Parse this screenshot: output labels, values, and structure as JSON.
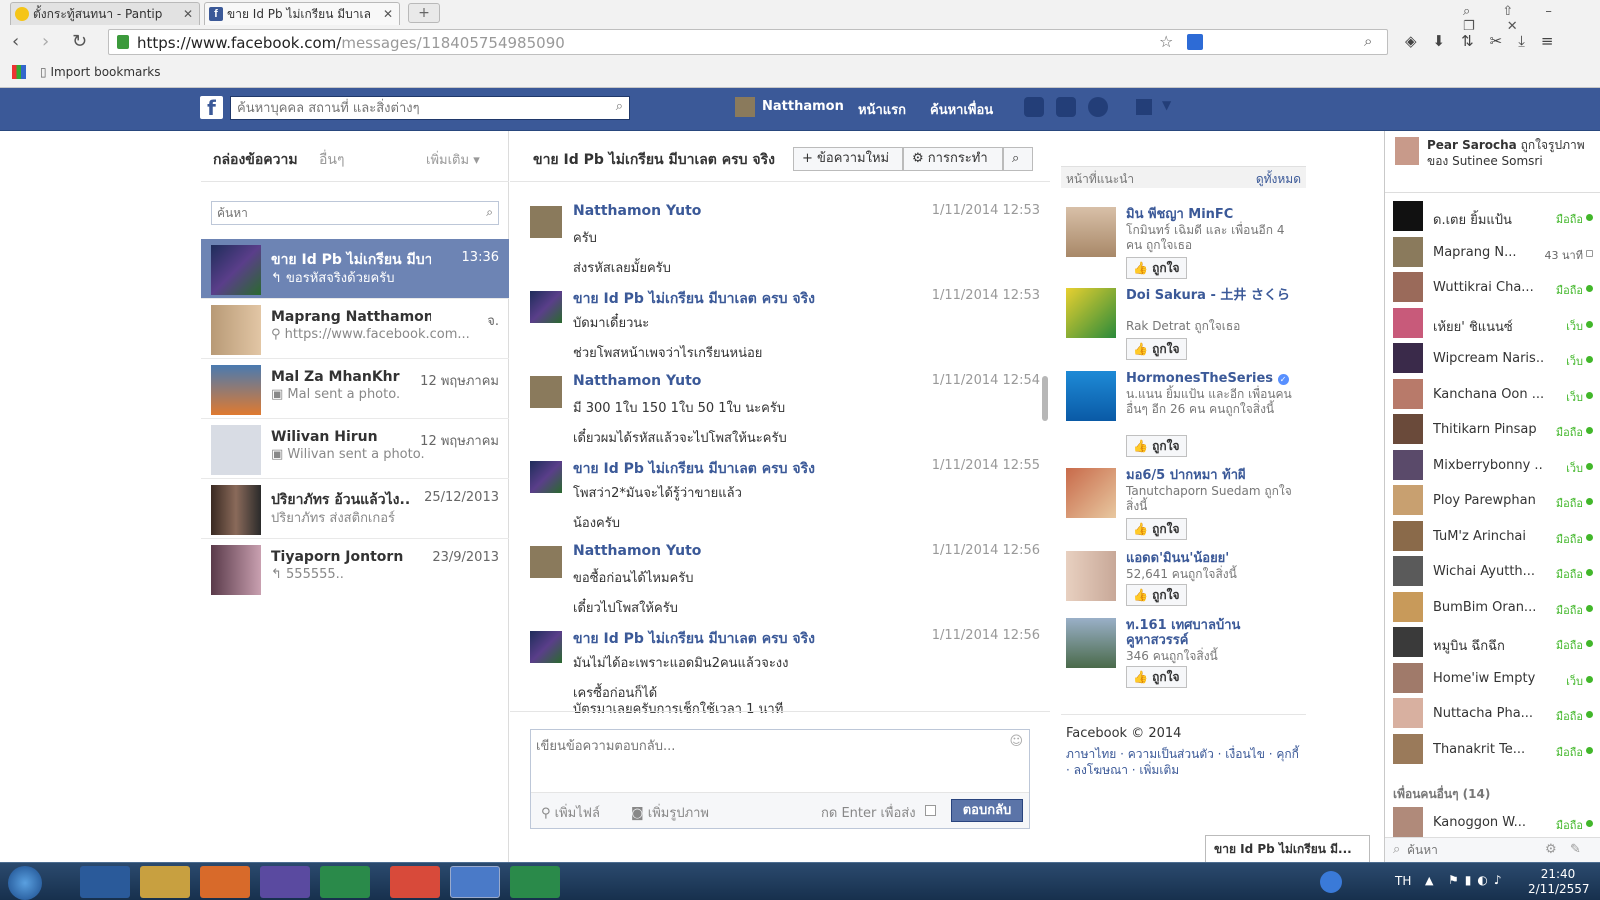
{
  "browser": {
    "tabs": [
      {
        "title": "ตั้งกระทู้สนทนา - Pantip"
      },
      {
        "title": "ขาย Id Pb ไม่เกรียน มีบาเล"
      }
    ],
    "new_tab": "+",
    "url_host": "https://www.facebook.com/",
    "url_path": "messages/118405754985090",
    "bookmark": "Import bookmarks"
  },
  "fb_header": {
    "search_placeholder": "ค้นหาบุคคล สถานที่ และสิ่งต่างๆ",
    "user_name": "Natthamon",
    "home": "หน้าแรก",
    "find_friends": "ค้นหาเพื่อน"
  },
  "inbox": {
    "title": "กล่องข้อความ",
    "other": "อื่นๆ",
    "more": "เพิ่มเติม",
    "search_placeholder": "ค้นหา",
    "conversations": [
      {
        "name": "ขาย Id Pb ไม่เกรียน มีบาเล.",
        "date": "13:36",
        "snippet": "ขอรหัสจริงด้วยครับ"
      },
      {
        "name": "Maprang Natthamon Yuto",
        "date": "จ.",
        "snippet": "https://www.facebook.com..."
      },
      {
        "name": "Mal Za MhanKhr",
        "date": "12 พฤษภาคม",
        "snippet": "Mal sent a photo."
      },
      {
        "name": "Wilivan Hirun",
        "date": "12 พฤษภาคม",
        "snippet": "Wilivan sent a photo."
      },
      {
        "name": "ปริยาภัทร อ้วนแล้วไง..",
        "date": "25/12/2013",
        "snippet": "ปริยาภัทร ส่งสติกเกอร์"
      },
      {
        "name": "Tiyaporn Jontorn",
        "date": "23/9/2013",
        "snippet": "555555.."
      }
    ]
  },
  "thread": {
    "title": "ขาย Id Pb ไม่เกรียน มีบาเลต ครบ จริง",
    "new_message": "ข้อความใหม่",
    "actions": "การกระทำ",
    "messages": [
      {
        "sender": "Natthamon Yuto",
        "time": "1/11/2014 12:53",
        "lines": [
          "ครับ",
          "ส่งรหัสเลยมั้ยครับ"
        ]
      },
      {
        "sender": "ขาย Id Pb ไม่เกรียน มีบาเลต ครบ จริง",
        "time": "1/11/2014 12:53",
        "lines": [
          "บัดมาเดี๋ยวนะ",
          "ช่วยโพสหน้าเพจว่าไรเกรียนหน่อย"
        ]
      },
      {
        "sender": "Natthamon Yuto",
        "time": "1/11/2014 12:54",
        "lines": [
          "มี 300 1ใบ 150 1ใบ 50 1ใบ นะครับ",
          "เดี๋ยวผมได้รหัสแล้วจะไปโพสให้นะครับ"
        ]
      },
      {
        "sender": "ขาย Id Pb ไม่เกรียน มีบาเลต ครบ จริง",
        "time": "1/11/2014 12:55",
        "lines": [
          "โพสว่า2*มันจะได้รู้ว่าขายแล้ว",
          "น้องครับ"
        ]
      },
      {
        "sender": "Natthamon Yuto",
        "time": "1/11/2014 12:56",
        "lines": [
          "ขอซื้อก่อนได้ไหมครับ",
          "เดี๋ยวไปโพสให้ครับ"
        ]
      },
      {
        "sender": "ขาย Id Pb ไม่เกรียน มีบาเลต ครบ จริง",
        "time": "1/11/2014 12:56",
        "lines": [
          "มันไม่ได้อะเพราะแอดมิน2คนแล้วจะงง",
          "เครซื้อก่อนก็ได้",
          "บัตรมาเลยครับการเช็กใช้เวลา 1 นาที"
        ]
      }
    ],
    "reply_placeholder": "เขียนข้อความตอบกลับ...",
    "add_file": "เพิ่มไฟล์",
    "add_photo": "เพิ่มรูปภาพ",
    "enter_to_send": "กด Enter เพื่อส่ง",
    "reply_button": "ตอบกลับ"
  },
  "recommended": {
    "title": "หน้าที่แนะนำ",
    "see_all": "ดูทั้งหมด",
    "like_label": "ถูกใจ",
    "pages": [
      {
        "name": "มิน พีชญา MinFC",
        "desc": "โกมินทร์ เฉิมดี และ เพื่อนอีก 4 คน ถูกใจเธอ"
      },
      {
        "name": "Doi Sakura - 土井 さくら",
        "desc": "Rak Detrat ถูกใจเธอ"
      },
      {
        "name": "HormonesTheSeries",
        "desc": "น.แนน ยิ้มแป้น และอีก เพื่อนคนอื่นๆ อีก 26 คน คนถูกใจสิ่งนี้"
      },
      {
        "name": "มอ6/5 ปากหมา ท้าผี",
        "desc": "Tanutchaporn Suedam ถูกใจสิ่งนี้"
      },
      {
        "name": "แอดด'มินน'น้อยย'",
        "desc": "52,641 คนถูกใจสิ่งนี้"
      },
      {
        "name": "ท.161 เทศบาลบ้านคูหาสวรรค์",
        "desc": "346 คนถูกใจสิ่งนี้"
      }
    ],
    "footer_copy": "Facebook © 2014",
    "footer_links": "ภาษาไทย · ความเป็นส่วนตัว · เงื่อนไข · คุกกี้ · ลงโฆษณา · เพิ่มเติม"
  },
  "chat": {
    "ticker": {
      "name": "Pear Sarocha",
      "text": "ถูกใจรูปภาพ ของ Sutinee Somsri"
    },
    "users": [
      {
        "name": "ด.เตย ยิ้มแป้น",
        "status": "มือถือ"
      },
      {
        "name": "Maprang N...",
        "status": "43 นาที"
      },
      {
        "name": "Wuttikrai Cha...",
        "status": "มือถือ"
      },
      {
        "name": "เห้ยย' ชิแนนซ์",
        "status": "เว็บ"
      },
      {
        "name": "Wipcream Naris...",
        "status": "เว็บ"
      },
      {
        "name": "Kanchana Oon ...",
        "status": "เว็บ"
      },
      {
        "name": "Thitikarn Pinsap",
        "status": "มือถือ"
      },
      {
        "name": "Mixberrybonny ...",
        "status": "เว็บ"
      },
      {
        "name": "Ploy Parewphan",
        "status": "มือถือ"
      },
      {
        "name": "TuM'z Arinchai",
        "status": "มือถือ"
      },
      {
        "name": "Wichai Ayutth...",
        "status": "มือถือ"
      },
      {
        "name": "BumBim Oran...",
        "status": "มือถือ"
      },
      {
        "name": "หมูบิน ฉึกฉึก",
        "status": "มือถือ"
      },
      {
        "name": "Home'iw Empty",
        "status": "เว็บ"
      },
      {
        "name": "Nuttacha Pha...",
        "status": "มือถือ"
      },
      {
        "name": "Thanakrit Te...",
        "status": "มือถือ"
      }
    ],
    "more_friends": "เพื่อนคนอื่นๆ (14)",
    "more_user": {
      "name": "Kanoggon W...",
      "status": "มือถือ"
    },
    "search_placeholder": "ค้นหา"
  },
  "chat_tab": "ขาย Id Pb ไม่เกรียน มี...",
  "taskbar": {
    "lang": "TH",
    "time": "21:40",
    "date": "2/11/2557"
  }
}
